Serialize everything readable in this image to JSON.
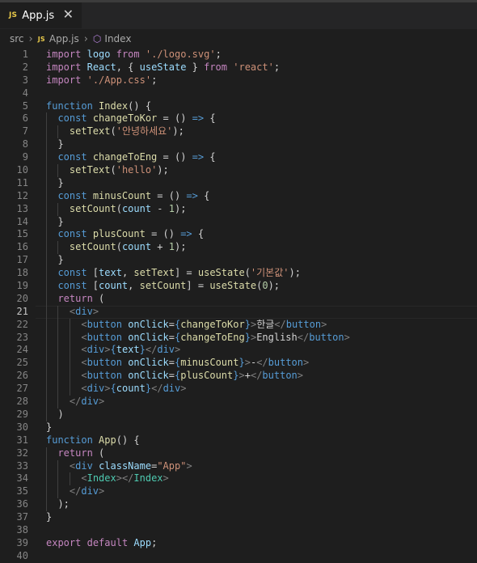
{
  "tab": {
    "badge": "JS",
    "filename": "App.js",
    "close": "✕"
  },
  "breadcrumb": {
    "folder": "src",
    "file_badge": "JS",
    "file": "App.js",
    "symbol": "Index"
  },
  "editor": {
    "current_line": 21,
    "lines": [
      [
        [
          "k",
          "import"
        ],
        [
          "p",
          " "
        ],
        [
          "v",
          "logo"
        ],
        [
          "p",
          " "
        ],
        [
          "k",
          "from"
        ],
        [
          "p",
          " "
        ],
        [
          "s",
          "'./logo.svg'"
        ],
        [
          "p",
          ";"
        ]
      ],
      [
        [
          "k",
          "import"
        ],
        [
          "p",
          " "
        ],
        [
          "v",
          "React"
        ],
        [
          "p",
          ", { "
        ],
        [
          "v",
          "useState"
        ],
        [
          "p",
          " } "
        ],
        [
          "k",
          "from"
        ],
        [
          "p",
          " "
        ],
        [
          "s",
          "'react'"
        ],
        [
          "p",
          ";"
        ]
      ],
      [
        [
          "k",
          "import"
        ],
        [
          "p",
          " "
        ],
        [
          "s",
          "'./App.css'"
        ],
        [
          "p",
          ";"
        ]
      ],
      [],
      [
        [
          "kw",
          "function"
        ],
        [
          "p",
          " "
        ],
        [
          "fn",
          "Index"
        ],
        [
          "p",
          "() {"
        ]
      ],
      [
        [
          "p",
          "  "
        ],
        [
          "kw",
          "const"
        ],
        [
          "p",
          " "
        ],
        [
          "fn",
          "changeToKor"
        ],
        [
          "p",
          " = () "
        ],
        [
          "kw",
          "=>"
        ],
        [
          "p",
          " {"
        ]
      ],
      [
        [
          "p",
          "    "
        ],
        [
          "fn",
          "setText"
        ],
        [
          "p",
          "("
        ],
        [
          "s",
          "'안녕하세요'"
        ],
        [
          "p",
          ");"
        ]
      ],
      [
        [
          "p",
          "  }"
        ]
      ],
      [
        [
          "p",
          "  "
        ],
        [
          "kw",
          "const"
        ],
        [
          "p",
          " "
        ],
        [
          "fn",
          "changeToEng"
        ],
        [
          "p",
          " = () "
        ],
        [
          "kw",
          "=>"
        ],
        [
          "p",
          " {"
        ]
      ],
      [
        [
          "p",
          "    "
        ],
        [
          "fn",
          "setText"
        ],
        [
          "p",
          "("
        ],
        [
          "s",
          "'hello'"
        ],
        [
          "p",
          ");"
        ]
      ],
      [
        [
          "p",
          "  }"
        ]
      ],
      [
        [
          "p",
          "  "
        ],
        [
          "kw",
          "const"
        ],
        [
          "p",
          " "
        ],
        [
          "fn",
          "minusCount"
        ],
        [
          "p",
          " = () "
        ],
        [
          "kw",
          "=>"
        ],
        [
          "p",
          " {"
        ]
      ],
      [
        [
          "p",
          "    "
        ],
        [
          "fn",
          "setCount"
        ],
        [
          "p",
          "("
        ],
        [
          "v",
          "count"
        ],
        [
          "p",
          " - "
        ],
        [
          "n",
          "1"
        ],
        [
          "p",
          ");"
        ]
      ],
      [
        [
          "p",
          "  }"
        ]
      ],
      [
        [
          "p",
          "  "
        ],
        [
          "kw",
          "const"
        ],
        [
          "p",
          " "
        ],
        [
          "fn",
          "plusCount"
        ],
        [
          "p",
          " = () "
        ],
        [
          "kw",
          "=>"
        ],
        [
          "p",
          " {"
        ]
      ],
      [
        [
          "p",
          "    "
        ],
        [
          "fn",
          "setCount"
        ],
        [
          "p",
          "("
        ],
        [
          "v",
          "count"
        ],
        [
          "p",
          " + "
        ],
        [
          "n",
          "1"
        ],
        [
          "p",
          ");"
        ]
      ],
      [
        [
          "p",
          "  }"
        ]
      ],
      [
        [
          "p",
          "  "
        ],
        [
          "kw",
          "const"
        ],
        [
          "p",
          " ["
        ],
        [
          "v",
          "text"
        ],
        [
          "p",
          ", "
        ],
        [
          "fn",
          "setText"
        ],
        [
          "p",
          "] = "
        ],
        [
          "fn",
          "useState"
        ],
        [
          "p",
          "("
        ],
        [
          "s",
          "'기본값'"
        ],
        [
          "p",
          ");"
        ]
      ],
      [
        [
          "p",
          "  "
        ],
        [
          "kw",
          "const"
        ],
        [
          "p",
          " ["
        ],
        [
          "v",
          "count"
        ],
        [
          "p",
          ", "
        ],
        [
          "fn",
          "setCount"
        ],
        [
          "p",
          "] = "
        ],
        [
          "fn",
          "useState"
        ],
        [
          "p",
          "("
        ],
        [
          "n",
          "0"
        ],
        [
          "p",
          ");"
        ]
      ],
      [
        [
          "p",
          "  "
        ],
        [
          "k",
          "return"
        ],
        [
          "p",
          " ("
        ]
      ],
      [
        [
          "p",
          "    "
        ],
        [
          "tg",
          "<"
        ],
        [
          "t",
          "div"
        ],
        [
          "tg",
          ">"
        ]
      ],
      [
        [
          "p",
          "      "
        ],
        [
          "tg",
          "<"
        ],
        [
          "t",
          "button"
        ],
        [
          "p",
          " "
        ],
        [
          "v",
          "onClick"
        ],
        [
          "p",
          "="
        ],
        [
          "kw",
          "{"
        ],
        [
          "fn",
          "changeToKor"
        ],
        [
          "kw",
          "}"
        ],
        [
          "tg",
          ">"
        ],
        [
          "p",
          "한글"
        ],
        [
          "tg",
          "</"
        ],
        [
          "t",
          "button"
        ],
        [
          "tg",
          ">"
        ]
      ],
      [
        [
          "p",
          "      "
        ],
        [
          "tg",
          "<"
        ],
        [
          "t",
          "button"
        ],
        [
          "p",
          " "
        ],
        [
          "v",
          "onClick"
        ],
        [
          "p",
          "="
        ],
        [
          "kw",
          "{"
        ],
        [
          "fn",
          "changeToEng"
        ],
        [
          "kw",
          "}"
        ],
        [
          "tg",
          ">"
        ],
        [
          "p",
          "English"
        ],
        [
          "tg",
          "</"
        ],
        [
          "t",
          "button"
        ],
        [
          "tg",
          ">"
        ]
      ],
      [
        [
          "p",
          "      "
        ],
        [
          "tg",
          "<"
        ],
        [
          "t",
          "div"
        ],
        [
          "tg",
          ">"
        ],
        [
          "kw",
          "{"
        ],
        [
          "v",
          "text"
        ],
        [
          "kw",
          "}"
        ],
        [
          "tg",
          "</"
        ],
        [
          "t",
          "div"
        ],
        [
          "tg",
          ">"
        ]
      ],
      [
        [
          "p",
          "      "
        ],
        [
          "tg",
          "<"
        ],
        [
          "t",
          "button"
        ],
        [
          "p",
          " "
        ],
        [
          "v",
          "onClick"
        ],
        [
          "p",
          "="
        ],
        [
          "kw",
          "{"
        ],
        [
          "fn",
          "minusCount"
        ],
        [
          "kw",
          "}"
        ],
        [
          "tg",
          ">"
        ],
        [
          "p",
          "-"
        ],
        [
          "tg",
          "</"
        ],
        [
          "t",
          "button"
        ],
        [
          "tg",
          ">"
        ]
      ],
      [
        [
          "p",
          "      "
        ],
        [
          "tg",
          "<"
        ],
        [
          "t",
          "button"
        ],
        [
          "p",
          " "
        ],
        [
          "v",
          "onClick"
        ],
        [
          "p",
          "="
        ],
        [
          "kw",
          "{"
        ],
        [
          "fn",
          "plusCount"
        ],
        [
          "kw",
          "}"
        ],
        [
          "tg",
          ">"
        ],
        [
          "p",
          "+"
        ],
        [
          "tg",
          "</"
        ],
        [
          "t",
          "button"
        ],
        [
          "tg",
          ">"
        ]
      ],
      [
        [
          "p",
          "      "
        ],
        [
          "tg",
          "<"
        ],
        [
          "t",
          "div"
        ],
        [
          "tg",
          ">"
        ],
        [
          "kw",
          "{"
        ],
        [
          "v",
          "count"
        ],
        [
          "kw",
          "}"
        ],
        [
          "tg",
          "</"
        ],
        [
          "t",
          "div"
        ],
        [
          "tg",
          ">"
        ]
      ],
      [
        [
          "p",
          "    "
        ],
        [
          "tg",
          "</"
        ],
        [
          "t",
          "div"
        ],
        [
          "tg",
          ">"
        ]
      ],
      [
        [
          "p",
          "  )"
        ]
      ],
      [
        [
          "p",
          "}"
        ]
      ],
      [
        [
          "kw",
          "function"
        ],
        [
          "p",
          " "
        ],
        [
          "fn",
          "App"
        ],
        [
          "p",
          "() {"
        ]
      ],
      [
        [
          "p",
          "  "
        ],
        [
          "k",
          "return"
        ],
        [
          "p",
          " ("
        ]
      ],
      [
        [
          "p",
          "    "
        ],
        [
          "tg",
          "<"
        ],
        [
          "t",
          "div"
        ],
        [
          "p",
          " "
        ],
        [
          "v",
          "className"
        ],
        [
          "p",
          "="
        ],
        [
          "s",
          "\"App\""
        ],
        [
          "tg",
          ">"
        ]
      ],
      [
        [
          "p",
          "      "
        ],
        [
          "tg",
          "<"
        ],
        [
          "comp",
          "Index"
        ],
        [
          "tg",
          "></"
        ],
        [
          "comp",
          "Index"
        ],
        [
          "tg",
          ">"
        ]
      ],
      [
        [
          "p",
          "    "
        ],
        [
          "tg",
          "</"
        ],
        [
          "t",
          "div"
        ],
        [
          "tg",
          ">"
        ]
      ],
      [
        [
          "p",
          "  );"
        ]
      ],
      [
        [
          "p",
          "}"
        ]
      ],
      [],
      [
        [
          "k",
          "export"
        ],
        [
          "p",
          " "
        ],
        [
          "k",
          "default"
        ],
        [
          "p",
          " "
        ],
        [
          "v",
          "App"
        ],
        [
          "p",
          ";"
        ]
      ],
      []
    ]
  }
}
